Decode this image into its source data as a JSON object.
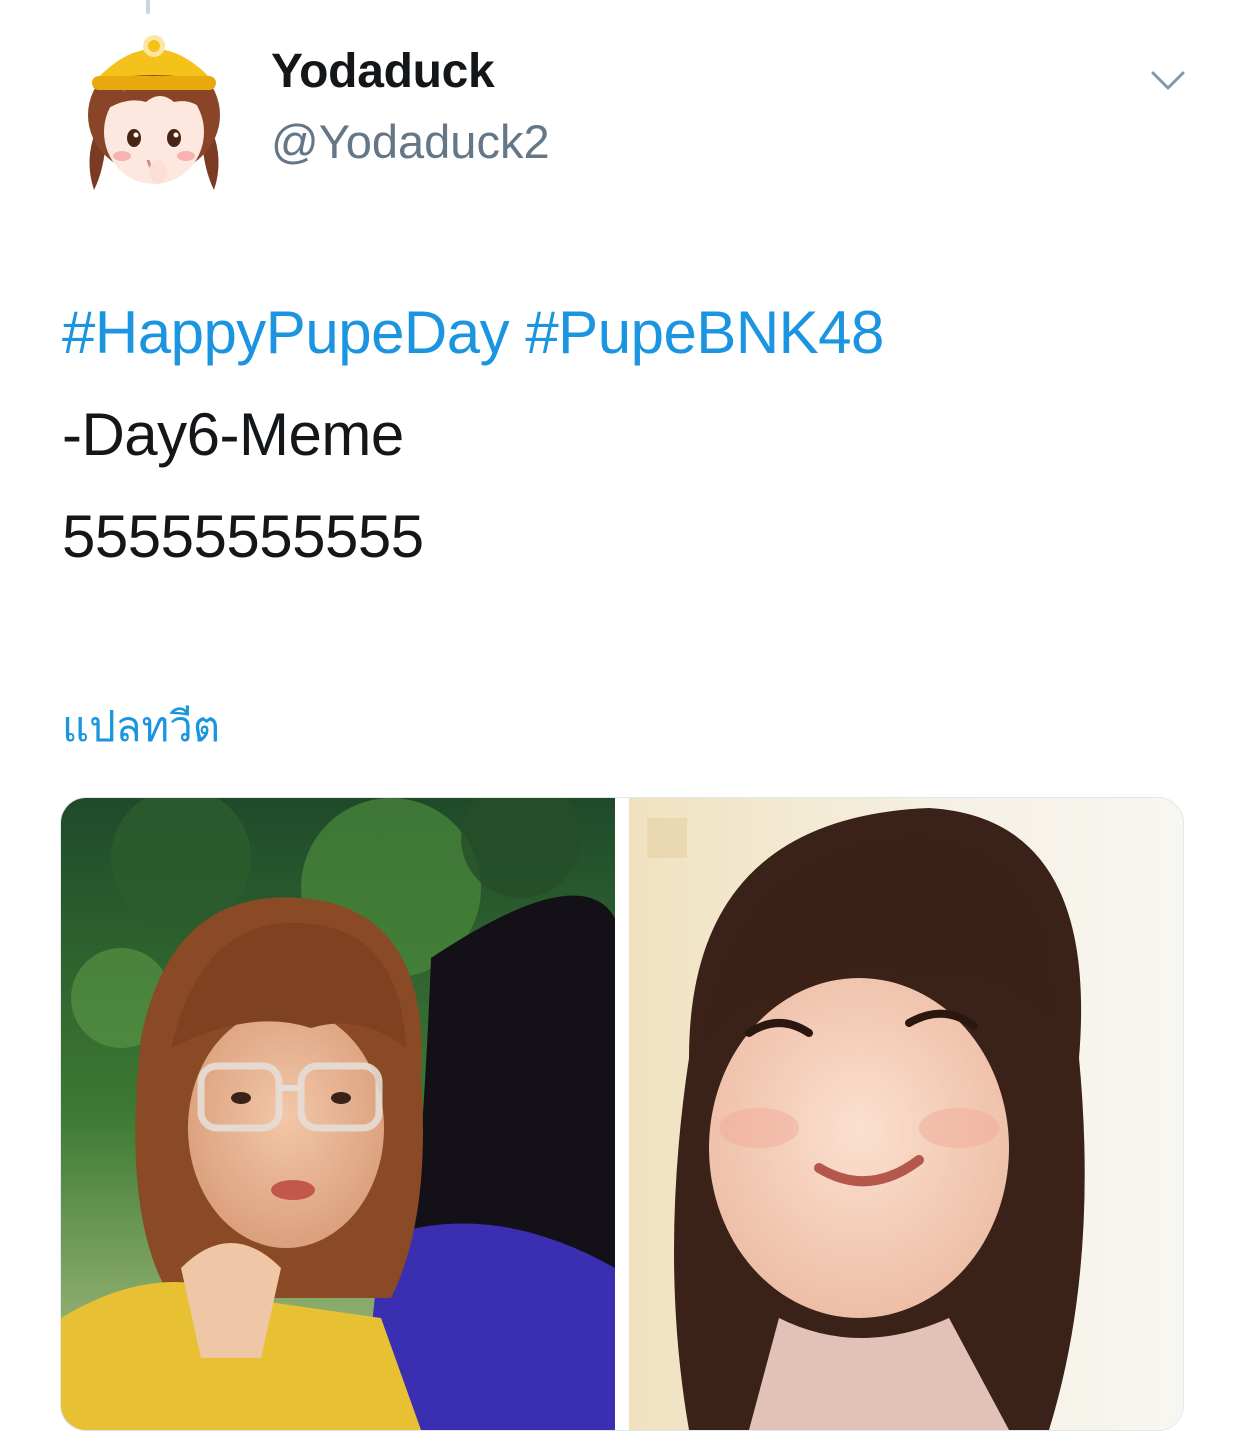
{
  "tweet": {
    "author": {
      "display_name": "Yodaduck",
      "handle": "@Yodaduck2"
    },
    "text": {
      "hashtags": [
        "#HappyPupeDay",
        "#PupeBNK48"
      ],
      "line2": "-Day6-Meme",
      "line3": "55555555555"
    },
    "translate_label": "แปลทวีต",
    "media": [
      {
        "alt": "photo-1"
      },
      {
        "alt": "photo-2"
      }
    ]
  },
  "icons": {
    "more": "chevron-down-icon"
  },
  "colors": {
    "link": "#1b95e0",
    "text": "#14171a",
    "secondary": "#657786"
  }
}
